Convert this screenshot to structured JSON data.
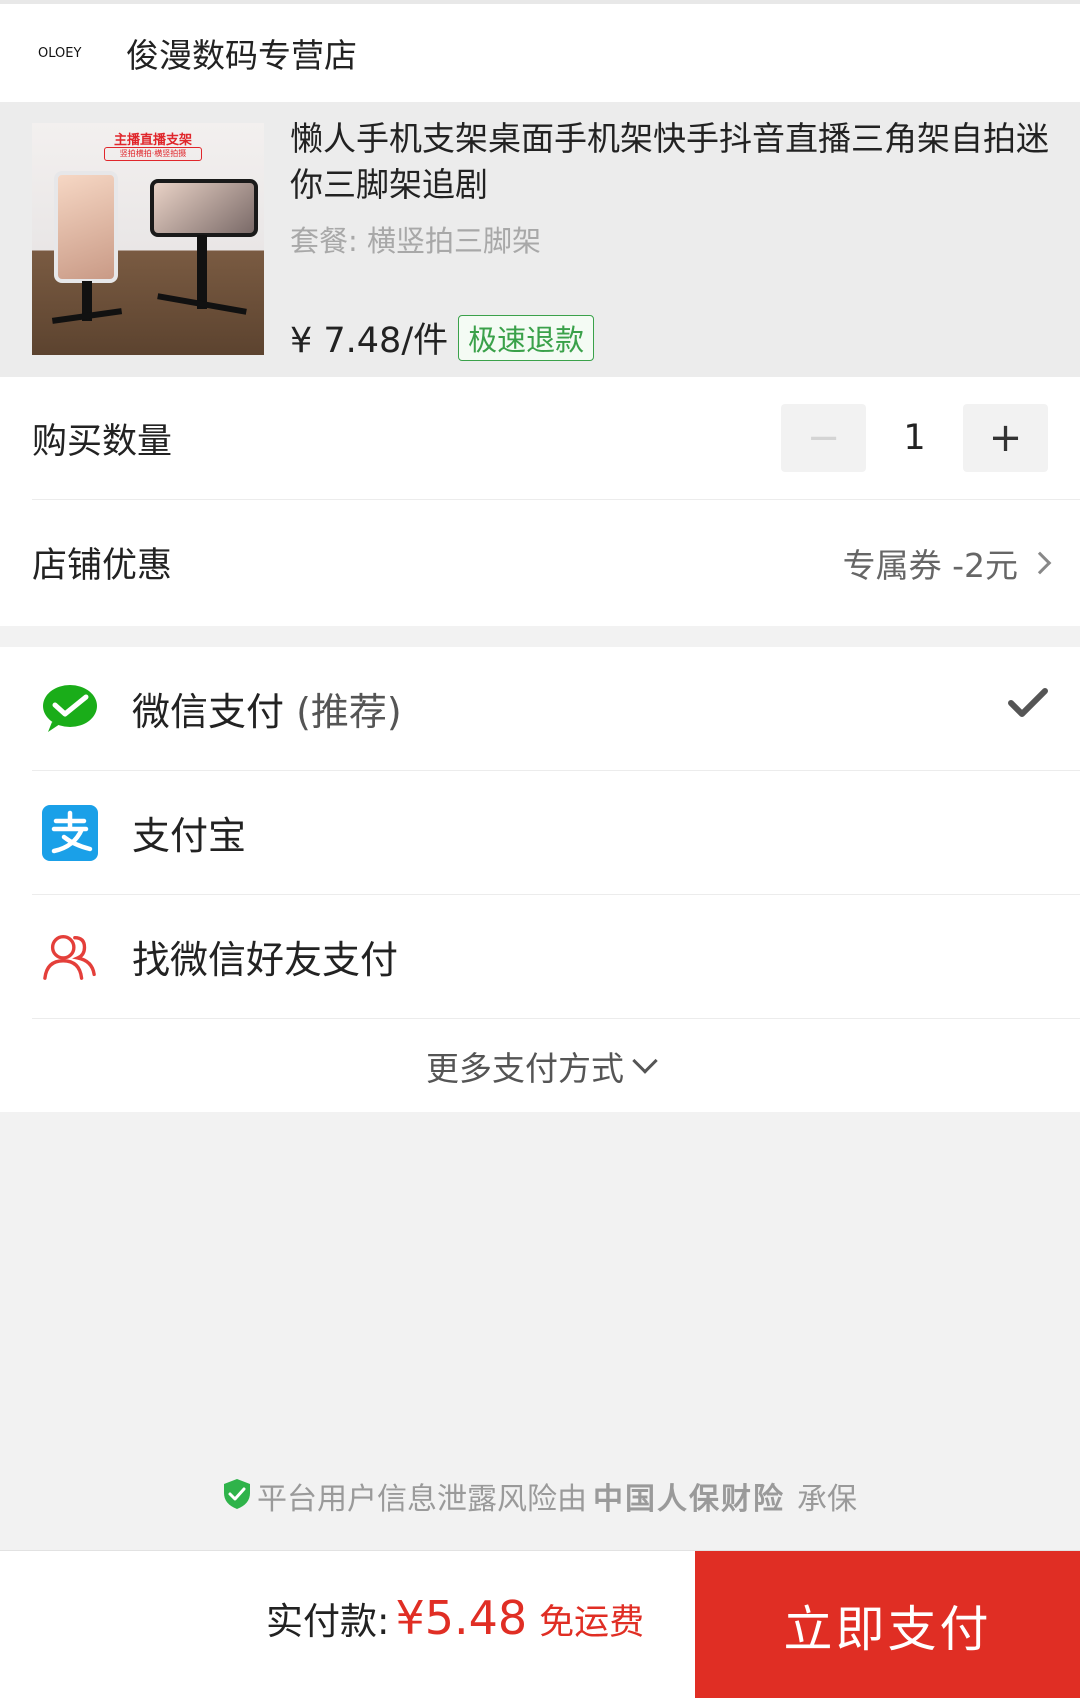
{
  "shop": {
    "logo_text": "OLOEY",
    "name": "俊漫数码专营店"
  },
  "product": {
    "image_banner": "主播直播支架",
    "image_subtext": "竖拍横拍·横竖拍摄",
    "title": "懒人手机支架桌面手机架快手抖音直播三角架自拍迷你三脚架追剧",
    "spec": "套餐: 横竖拍三脚架",
    "price": "¥ 7.48/件",
    "refund_badge": "极速退款"
  },
  "quantity": {
    "label": "购买数量",
    "minus": "−",
    "value": "1",
    "plus": "+"
  },
  "discount": {
    "label": "店铺优惠",
    "value": "专属券 -2元"
  },
  "payment": {
    "methods": [
      {
        "name": "微信支付",
        "note": "(推荐)",
        "icon": "wechat-pay-icon",
        "selected": true
      },
      {
        "name": "支付宝",
        "note": "",
        "icon": "alipay-icon",
        "selected": false
      },
      {
        "name": "找微信好友支付",
        "note": "",
        "icon": "friend-pay-icon",
        "selected": false
      }
    ],
    "more": "更多支付方式"
  },
  "insurance": {
    "prefix": "平台用户信息泄露风险由",
    "brand": "中国人保财险",
    "suffix": "承保"
  },
  "footer": {
    "total_label": "实付款:",
    "total_amount": "¥5.48",
    "shipping": "免运费",
    "pay_button": "立即支付"
  },
  "colors": {
    "accent_red": "#e02e24",
    "wechat_green": "#1aad19",
    "alipay_blue": "#1aa0e8",
    "refund_green": "#3aa14a"
  }
}
